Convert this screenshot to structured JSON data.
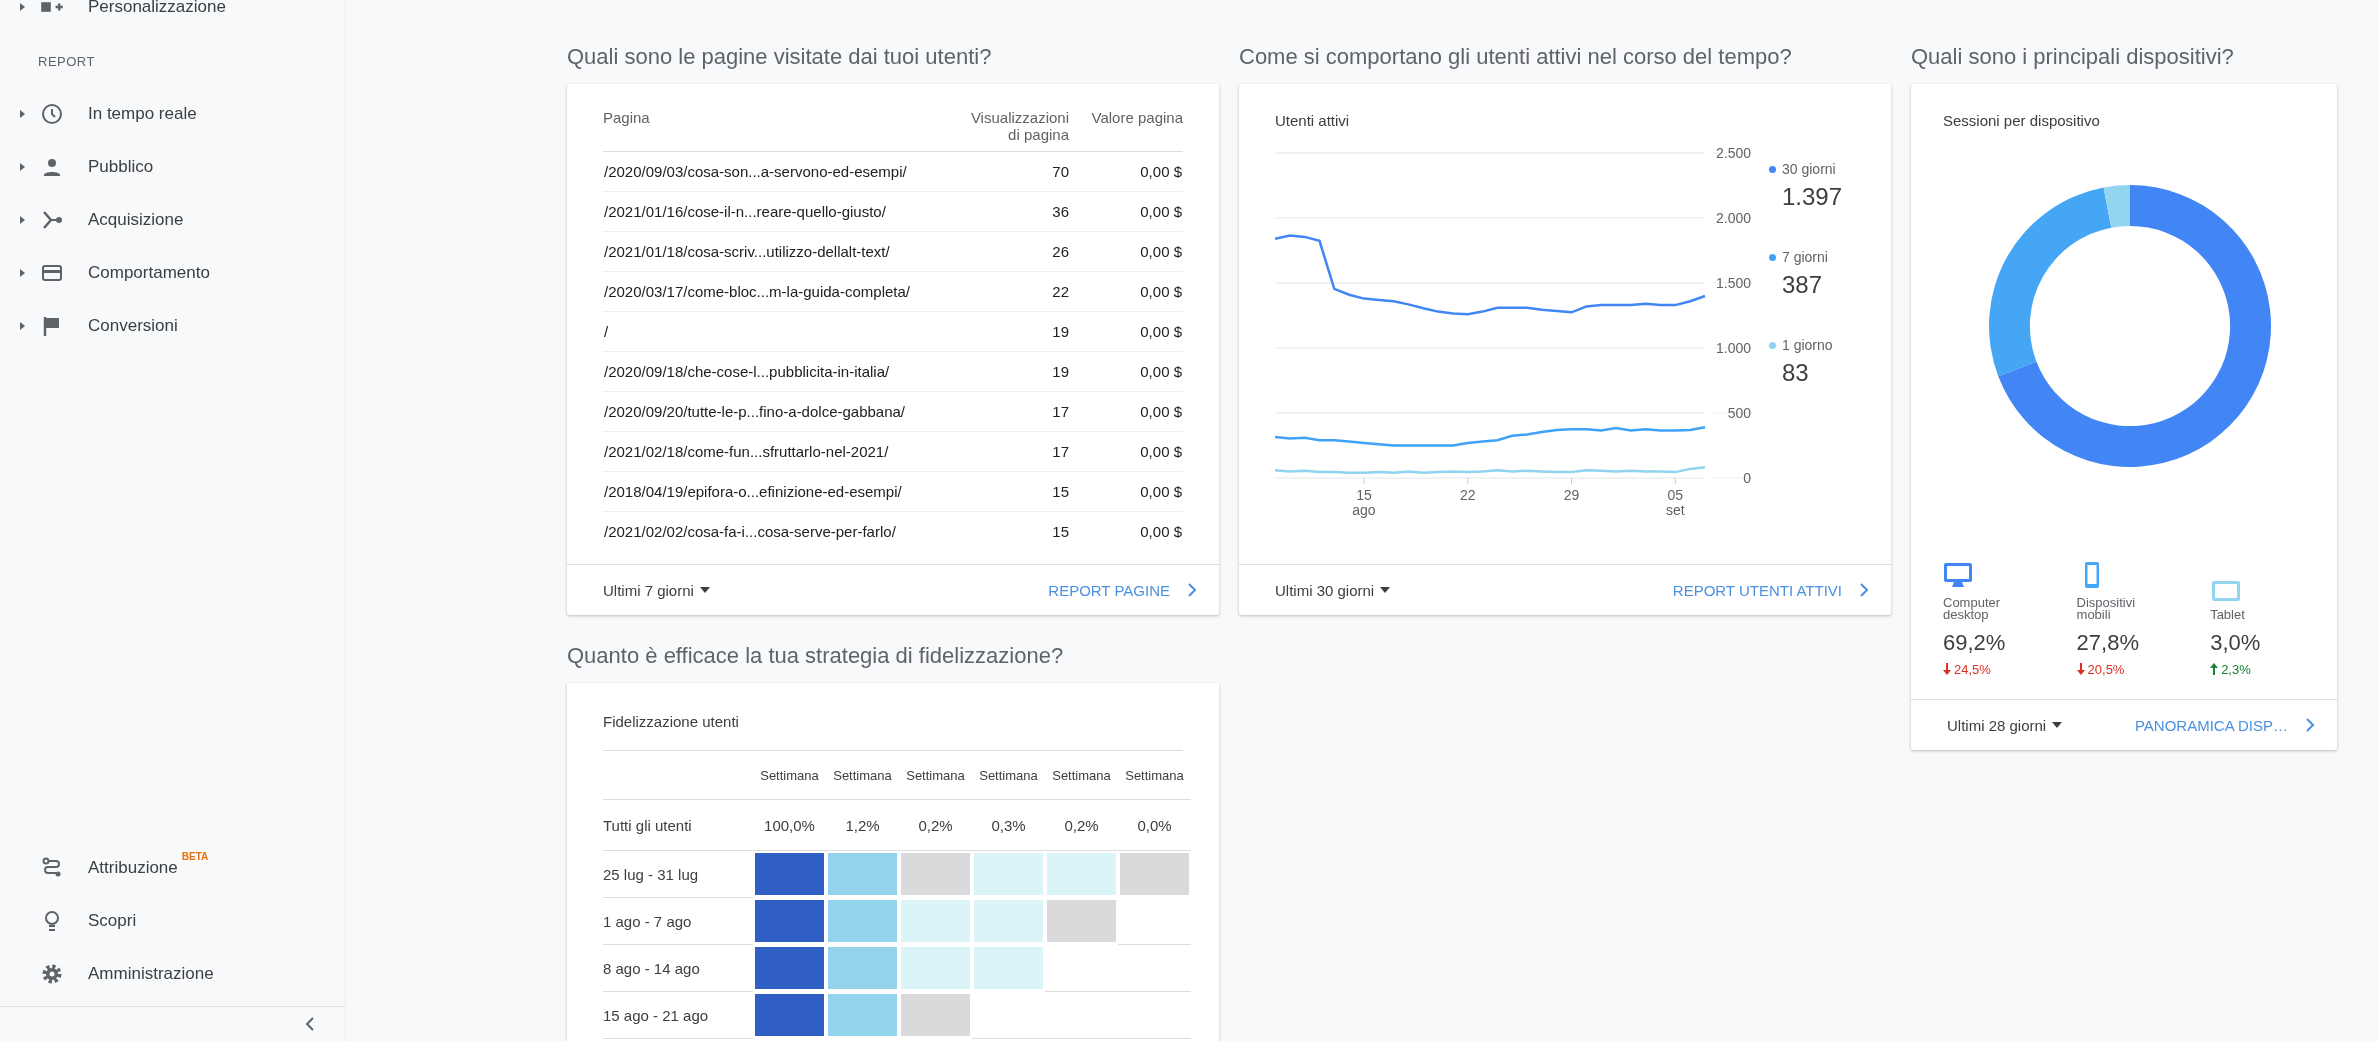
{
  "sidebar": {
    "top_item": {
      "label": "Personalizzazione",
      "expanded": false
    },
    "section_label": "REPORT",
    "report_items": [
      {
        "label": "In tempo reale",
        "expanded": false
      },
      {
        "label": "Pubblico",
        "expanded": false
      },
      {
        "label": "Acquisizione",
        "expanded": false
      },
      {
        "label": "Comportamento",
        "expanded": false
      },
      {
        "label": "Conversioni",
        "expanded": false
      }
    ],
    "bottom_items": [
      {
        "label": "Attribuzione",
        "badge": "BETA"
      },
      {
        "label": "Scopri"
      },
      {
        "label": "Amministrazione"
      }
    ]
  },
  "pages": {
    "question": "Quali sono le pagine visitate dai tuoi utenti?",
    "columns": [
      "Pagina",
      "Visualizzazioni di pagina",
      "Valore pagina"
    ],
    "rows": [
      {
        "page": "/2020/09/03/cosa-son...a-servono-ed-esempi/",
        "views": "70",
        "value": "0,00 $"
      },
      {
        "page": "/2021/01/16/cose-il-n...reare-quello-giusto/",
        "views": "36",
        "value": "0,00 $"
      },
      {
        "page": "/2021/01/18/cosa-scriv...utilizzo-dellalt-text/",
        "views": "26",
        "value": "0,00 $"
      },
      {
        "page": "/2020/03/17/come-bloc...m-la-guida-completa/",
        "views": "22",
        "value": "0,00 $"
      },
      {
        "page": "/",
        "views": "19",
        "value": "0,00 $"
      },
      {
        "page": "/2020/09/18/che-cose-l...pubblicita-in-italia/",
        "views": "19",
        "value": "0,00 $"
      },
      {
        "page": "/2020/09/20/tutte-le-p...fino-a-dolce-gabbana/",
        "views": "17",
        "value": "0,00 $"
      },
      {
        "page": "/2021/02/18/come-fun...sfruttarlo-nel-2021/",
        "views": "17",
        "value": "0,00 $"
      },
      {
        "page": "/2018/04/19/epifora-o...efinizione-ed-esempi/",
        "views": "15",
        "value": "0,00 $"
      },
      {
        "page": "/2021/02/02/cosa-fa-i...cosa-serve-per-farlo/",
        "views": "15",
        "value": "0,00 $"
      }
    ],
    "period": "Ultimi 7 giorni",
    "link": "REPORT PAGINE"
  },
  "active_users": {
    "question": "Come si comportano gli utenti attivi nel corso del tempo?",
    "title": "Utenti attivi",
    "chart_data": {
      "type": "line",
      "categories": [
        null,
        null,
        null,
        null,
        null,
        null,
        "15 ago",
        null,
        null,
        null,
        null,
        null,
        null,
        "22",
        null,
        null,
        null,
        null,
        null,
        null,
        "29",
        null,
        null,
        null,
        null,
        null,
        null,
        "05 set",
        null,
        null
      ],
      "series": [
        {
          "name": "30 giorni",
          "color": "#4285f4",
          "values": [
            1840,
            1865,
            1855,
            1825,
            1455,
            1410,
            1380,
            1370,
            1360,
            1335,
            1305,
            1280,
            1265,
            1260,
            1280,
            1310,
            1310,
            1310,
            1295,
            1285,
            1275,
            1320,
            1330,
            1330,
            1330,
            1340,
            1330,
            1330,
            1360,
            1400
          ]
        },
        {
          "name": "7 giorni",
          "color": "#3fa2f7",
          "values": [
            315,
            305,
            310,
            290,
            290,
            280,
            270,
            260,
            250,
            250,
            250,
            250,
            250,
            270,
            280,
            290,
            325,
            335,
            355,
            370,
            375,
            375,
            365,
            385,
            365,
            375,
            365,
            365,
            370,
            390
          ]
        },
        {
          "name": "1 giorno",
          "color": "#8fd3ee",
          "values": [
            60,
            50,
            55,
            45,
            45,
            40,
            40,
            45,
            40,
            50,
            40,
            45,
            50,
            45,
            50,
            60,
            50,
            55,
            50,
            45,
            45,
            60,
            55,
            50,
            55,
            50,
            50,
            45,
            70,
            83
          ]
        }
      ],
      "ylim": [
        0,
        2500
      ],
      "grid": true,
      "yticks": [
        {
          "value": 0,
          "label": "0"
        },
        {
          "value": 500,
          "label": "500"
        },
        {
          "value": 1000,
          "label": "1.000"
        },
        {
          "value": 1500,
          "label": "1.500"
        },
        {
          "value": 2000,
          "label": "2.000"
        },
        {
          "value": 2500,
          "label": "2.500"
        }
      ]
    },
    "legend": [
      {
        "value": "1.397"
      },
      {
        "value": "387"
      },
      {
        "value": "83"
      }
    ],
    "period": "Ultimi 30 giorni",
    "link": "REPORT UTENTI ATTIVI"
  },
  "devices": {
    "question": "Quali sono i principali dispositivi?",
    "title": "Sessioni per dispositivo",
    "chart_data": {
      "type": "donut",
      "categories": [
        "Computer desktop",
        "Dispositivi mobili",
        "Tablet"
      ],
      "values": [
        69.2,
        27.8,
        3.0
      ]
    },
    "stats": [
      {
        "share": "69,2%",
        "change": "24,5%",
        "increase": false,
        "color": "#4285f4"
      },
      {
        "share": "27,8%",
        "change": "20,5%",
        "increase": false,
        "color": "#45a6f5"
      },
      {
        "share": "3,0%",
        "change": "2,3%",
        "increase": true,
        "color": "#93d4ee"
      }
    ],
    "period": "Ultimi 28 giorni",
    "link": "PANORAMICA DISP…"
  },
  "retention": {
    "question": "Quanto è efficace la tua strategia di fidelizzazione?",
    "title": "Fidelizzazione utenti",
    "columns": [
      "Settimana",
      "Settimana",
      "Settimana",
      "Settimana",
      "Settimana",
      "Settimana"
    ],
    "total": {
      "label": "Tutti gli utenti",
      "values": [
        "100,0%",
        "1,2%",
        "0,2%",
        "0,3%",
        "0,2%",
        "0,0%"
      ]
    },
    "rows": [
      {
        "label": "25 lug - 31 lug",
        "cells": [
          {
            "color": "#2f5ec4"
          },
          {
            "color": "#93d4ec"
          },
          {
            "color": "#dadadd"
          },
          {
            "color": "#dbf4f8"
          },
          {
            "color": "#dbf4f8"
          },
          {
            "color": "#dadadd"
          }
        ]
      },
      {
        "label": "1 ago - 7 ago",
        "cells": [
          {
            "color": "#2f5ec4"
          },
          {
            "color": "#93d4ec"
          },
          {
            "color": "#dbf4f8"
          },
          {
            "color": "#dbf4f8"
          },
          {
            "color": "#dadadd"
          }
        ]
      },
      {
        "label": "8 ago - 14 ago",
        "cells": [
          {
            "color": "#2f5ec4"
          },
          {
            "color": "#93d4ec"
          },
          {
            "color": "#dbf4f8"
          },
          {
            "color": "#dbf4f8"
          }
        ]
      },
      {
        "label": "15 ago - 21 ago",
        "cells": [
          {
            "color": "#2f5ec4"
          },
          {
            "color": "#93d4ec"
          },
          {
            "color": "#dadadd"
          }
        ]
      }
    ]
  }
}
